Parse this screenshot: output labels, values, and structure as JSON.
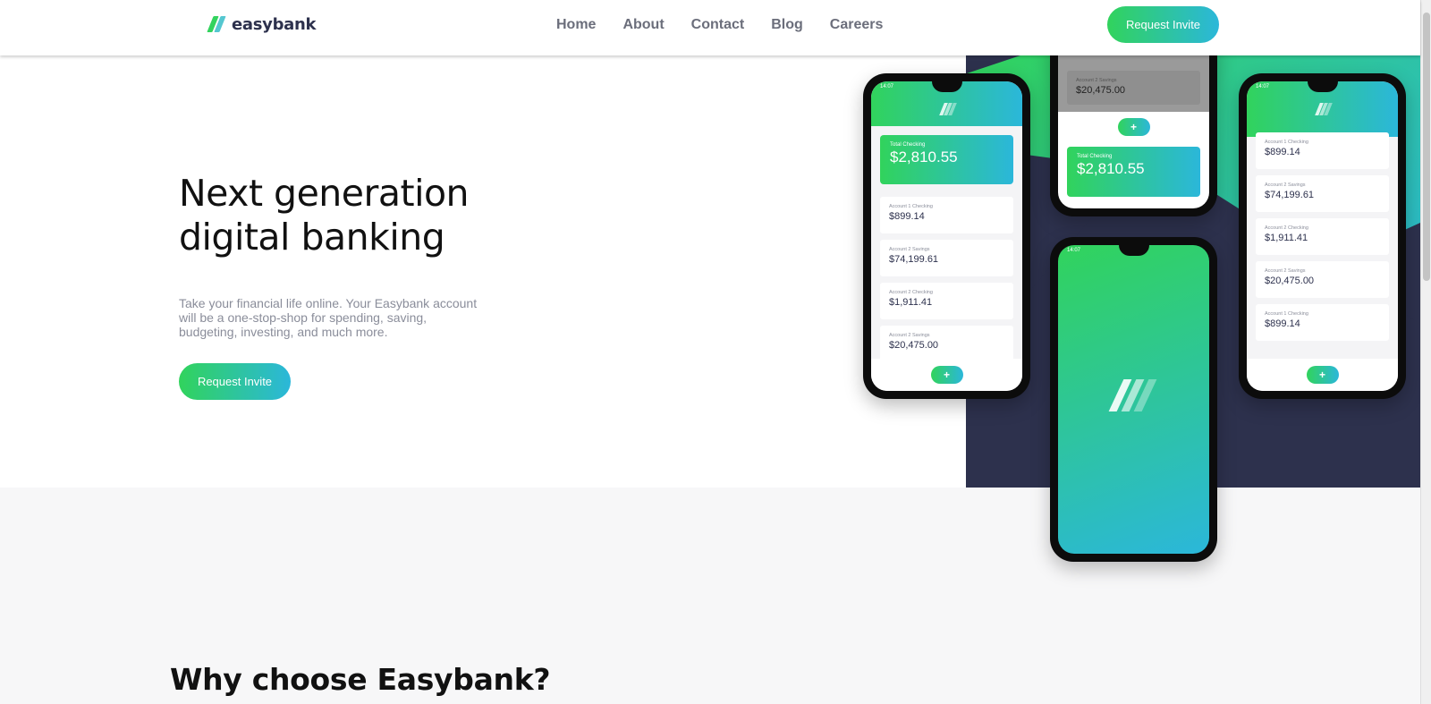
{
  "header": {
    "logo_text": "easybank",
    "nav": [
      "Home",
      "About",
      "Contact",
      "Blog",
      "Careers"
    ],
    "cta": "Request Invite"
  },
  "hero": {
    "title": "Next generation digital banking",
    "description": "Take your financial life online. Your Easybank account will be a one-stop-shop for spending, saving, budgeting, investing, and much more.",
    "cta": "Request Invite"
  },
  "phones": {
    "time": "14:07",
    "phone1": {
      "total_label": "Total Checking",
      "total_amount": "$2,810.55",
      "accounts": [
        {
          "label": "Account 1 Checking",
          "amount": "$899.14"
        },
        {
          "label": "Account 2 Savings",
          "amount": "$74,199.61"
        },
        {
          "label": "Account 2 Checking",
          "amount": "$1,911.41"
        },
        {
          "label": "Account 2 Savings",
          "amount": "$20,475.00"
        }
      ]
    },
    "phone2": {
      "account": {
        "label": "Account 2 Savings",
        "amount": "$20,475.00"
      },
      "total_label": "Total Checking",
      "total_amount": "$2,810.55"
    },
    "phone4": {
      "accounts": [
        {
          "label": "Account 1 Checking",
          "amount": "$899.14"
        },
        {
          "label": "Account 2 Savings",
          "amount": "$74,199.61"
        },
        {
          "label": "Account 2 Checking",
          "amount": "$1,911.41"
        },
        {
          "label": "Account 2 Savings",
          "amount": "$20,475.00"
        },
        {
          "label": "Account 1 Checking",
          "amount": "$899.14"
        }
      ]
    },
    "fab_symbol": "+"
  },
  "section2": {
    "title": "Why choose Easybank?"
  },
  "colors": {
    "green": "#31d35c",
    "cyan": "#2bb7da",
    "navy": "#2d314d"
  }
}
